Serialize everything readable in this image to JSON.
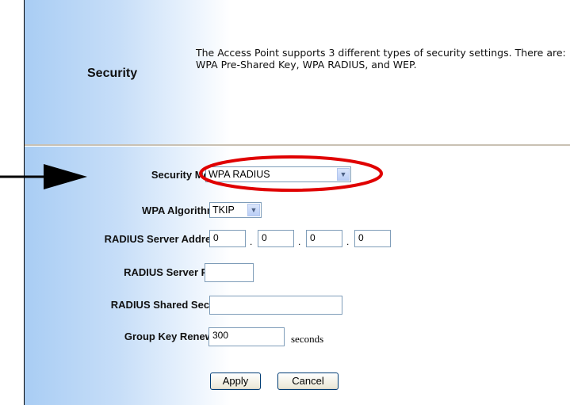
{
  "header": {
    "section_title": "Security",
    "description": "The Access Point supports 3 different types of security settings. There are: WPA Pre-Shared Key, WPA RADIUS, and WEP."
  },
  "form": {
    "security_mode": {
      "label": "Security Mode:",
      "value": "WPA RADIUS"
    },
    "wpa_algorithms": {
      "label": "WPA Algorithms:",
      "value": "TKIP"
    },
    "radius_server_address": {
      "label": "RADIUS Server Address:",
      "octets": [
        "0",
        "0",
        "0",
        "0"
      ],
      "separator": "."
    },
    "radius_server_port": {
      "label": "RADIUS Server Port:",
      "value": ""
    },
    "radius_shared_secret": {
      "label": "RADIUS Shared Secret:",
      "value": ""
    },
    "group_key_renewal": {
      "label": "Group Key Renewal:",
      "value": "300",
      "unit": "seconds"
    }
  },
  "buttons": {
    "apply": "Apply",
    "cancel": "Cancel"
  },
  "annotation": {
    "highlight_color": "#e00000",
    "arrow_color": "#000000"
  }
}
